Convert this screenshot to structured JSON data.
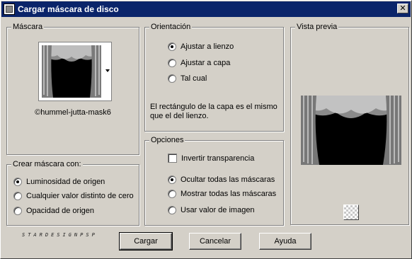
{
  "window": {
    "title": "Cargar máscara de disco",
    "close_glyph": "✕"
  },
  "mask": {
    "legend": "Máscara",
    "mask_name": "©hummel-jutta-mask6",
    "dropdown_icon": "chevron-down-icon"
  },
  "orientation": {
    "legend": "Orientación",
    "options": [
      {
        "label": "Ajustar a lienzo",
        "checked": true
      },
      {
        "label": "Ajustar a capa",
        "checked": false
      },
      {
        "label": "Tal cual",
        "checked": false
      }
    ],
    "description_line1": "El rectángulo de la capa es el mismo",
    "description_line2": "que el del lienzo."
  },
  "preview": {
    "legend": "Vista previa",
    "checker_icon": "transparency-icon"
  },
  "create_mask": {
    "legend": "Crear máscara con:",
    "options": [
      {
        "label": "Luminosidad de origen",
        "checked": true
      },
      {
        "label": "Cualquier valor distinto de cero",
        "checked": false
      },
      {
        "label": "Opacidad de origen",
        "checked": false
      }
    ]
  },
  "options": {
    "legend": "Opciones",
    "invert": {
      "label": "Invertir transparencia",
      "checked": false
    },
    "radios": [
      {
        "label": "Ocultar todas las máscaras",
        "checked": true
      },
      {
        "label": "Mostrar todas las máscaras",
        "checked": false
      },
      {
        "label": "Usar valor de imagen",
        "checked": false
      }
    ]
  },
  "watermark": "STARDESIGNPSP",
  "buttons": {
    "load": "Cargar",
    "cancel": "Cancelar",
    "help": "Ayuda"
  },
  "colors": {
    "titlebar": "#0a246a",
    "face": "#d4d0c8"
  }
}
